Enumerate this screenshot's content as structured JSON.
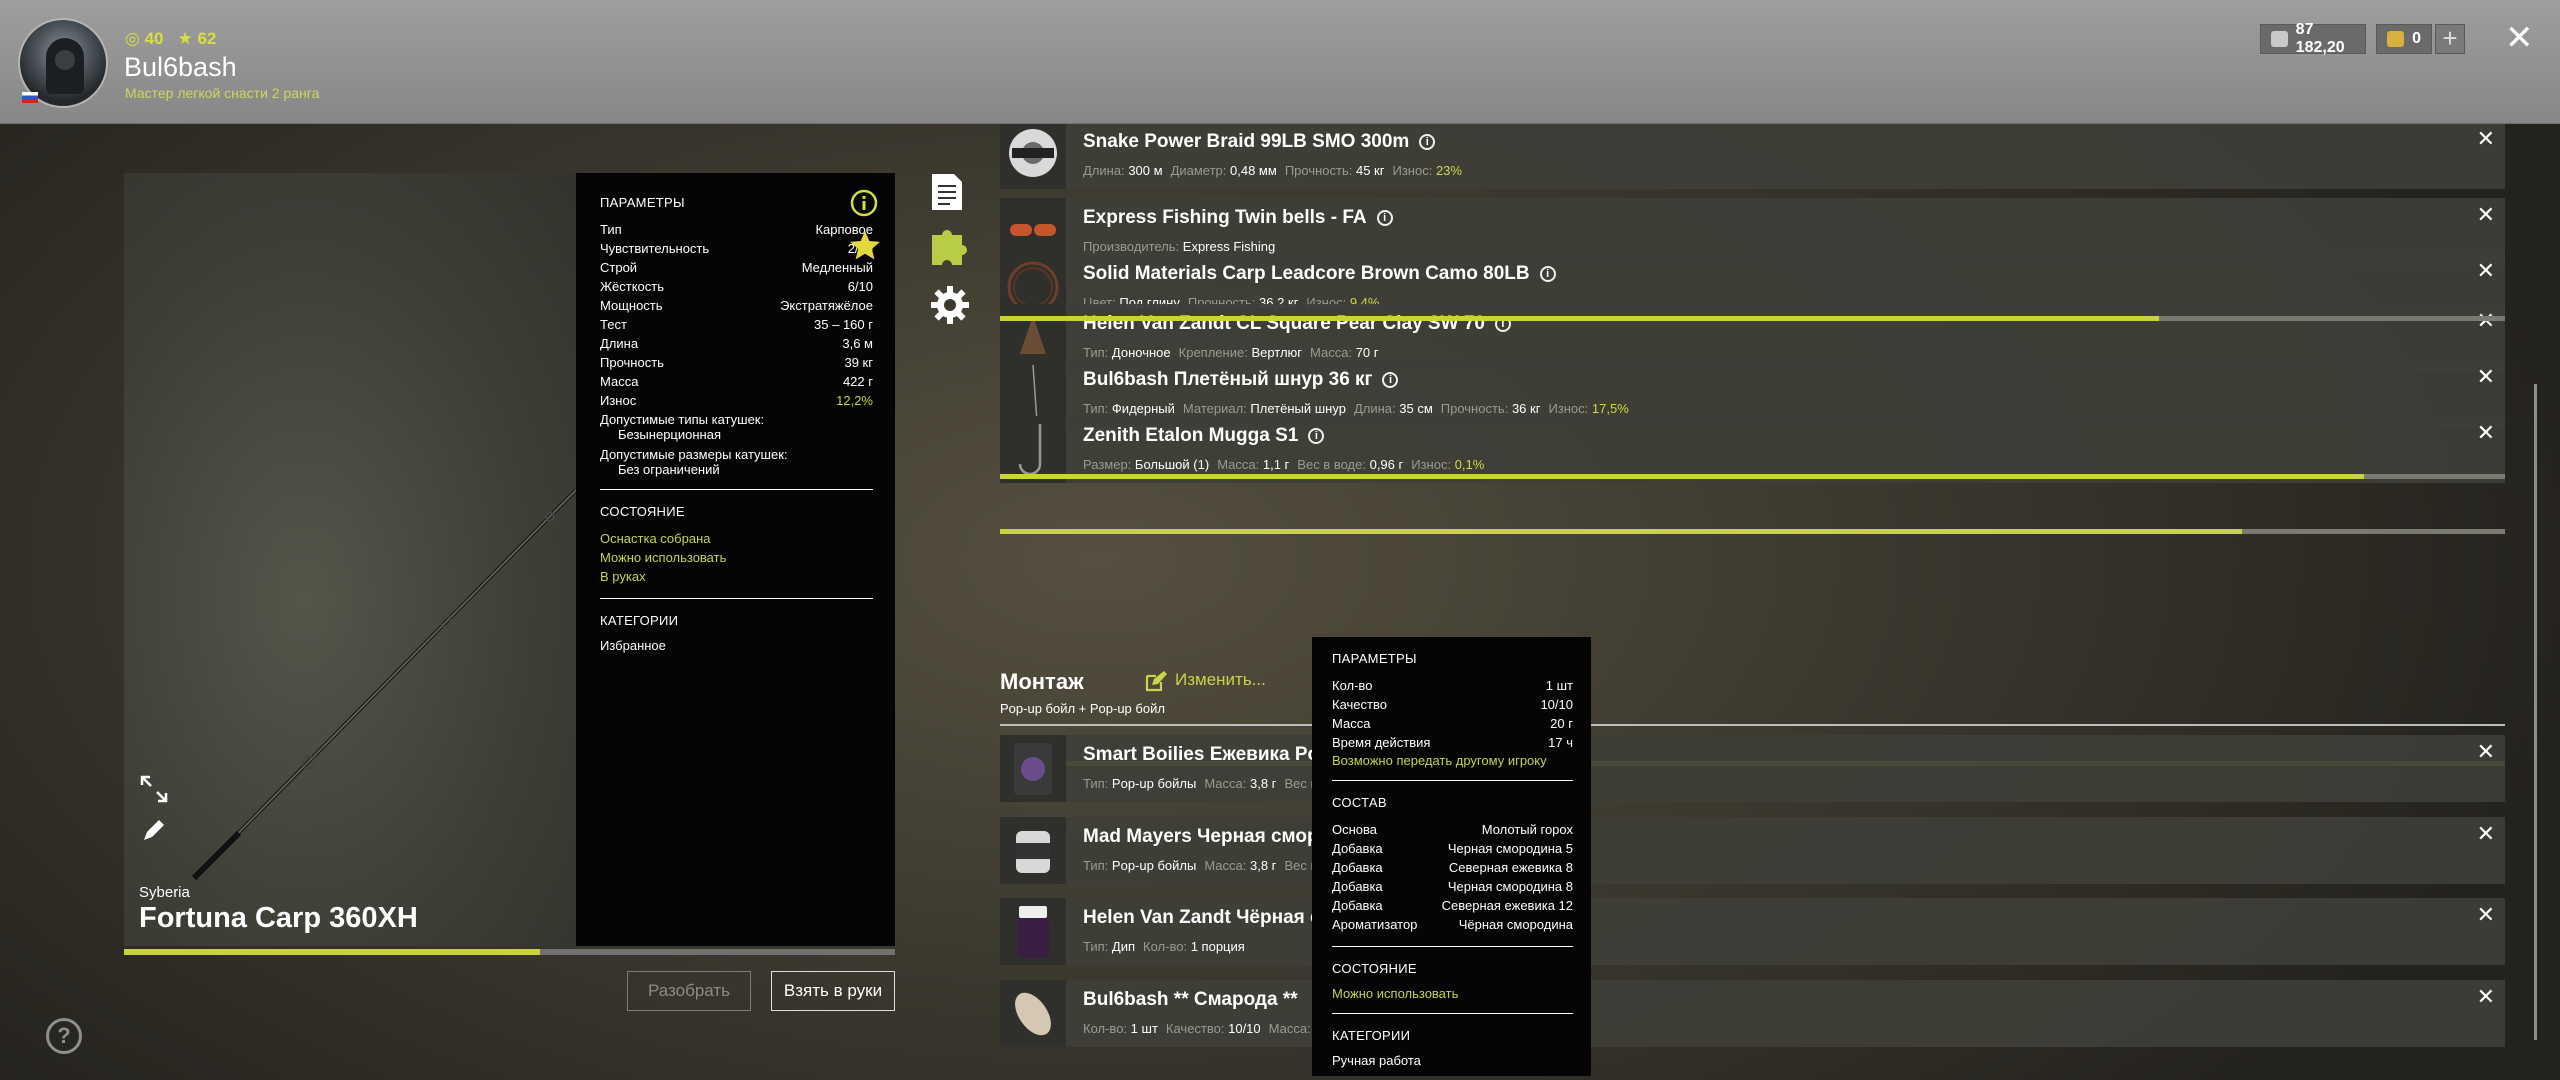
{
  "header": {
    "username": "Bul6bash",
    "rank": "Мастер легкой снасти 2 ранга",
    "level": "40",
    "stars": "62",
    "silver": "87 182,20",
    "gold": "0",
    "plus": "+",
    "close": "✕"
  },
  "rod": {
    "maker": "Syberia",
    "name": "Fortuna Carp 360XH",
    "wear_fraction": 0.54,
    "buttons": {
      "disassemble": "Разобрать",
      "take": "Взять в руки"
    },
    "params_title": "ПАРАМЕТРЫ",
    "params": [
      {
        "k": "Тип",
        "v": "Карповое"
      },
      {
        "k": "Чувствительность",
        "v": "2/10"
      },
      {
        "k": "Строй",
        "v": "Медленный"
      },
      {
        "k": "Жёсткость",
        "v": "6/10"
      },
      {
        "k": "Мощность",
        "v": "Экстратяжёлое"
      },
      {
        "k": "Тест",
        "v": "35 – 160 г"
      },
      {
        "k": "Длина",
        "v": "3,6 м"
      },
      {
        "k": "Прочность",
        "v": "39 кг"
      },
      {
        "k": "Масса",
        "v": "422 г"
      },
      {
        "k": "Износ",
        "v": "12,2%"
      }
    ],
    "reel_types_label": "Допустимые типы катушек:",
    "reel_types_value": "Безынерционная",
    "reel_sizes_label": "Допустимые размеры катушек:",
    "reel_sizes_value": "Без ограничений",
    "state_title": "СОСТОЯНИЕ",
    "state": [
      "Оснастка собрана",
      "Можно использовать",
      "В руках"
    ],
    "cat_title": "КАТЕГОРИИ",
    "cat": "Избранное"
  },
  "items": [
    {
      "name": "Snake Power Braid 99LB SMO 300m",
      "props": [
        {
          "k": "Длина:",
          "v": "300 м"
        },
        {
          "k": "Диаметр:",
          "v": "0,48 мм"
        },
        {
          "k": "Прочность:",
          "v": "45 кг"
        },
        {
          "k": "Износ:",
          "v": "23%",
          "g": true
        }
      ],
      "wear": 0.77
    },
    {
      "name": "Express Fishing Twin bells - FA",
      "props": [
        {
          "k": "Производитель:",
          "v": "Express Fishing"
        }
      ]
    },
    {
      "name": "Solid Materials Carp Leadcore Brown Camo 80LB",
      "props": [
        {
          "k": "Цвет:",
          "v": "Под глину"
        },
        {
          "k": "Прочность:",
          "v": "36,2 кг"
        },
        {
          "k": "Износ:",
          "v": "9,4%",
          "g": true
        }
      ],
      "wear": 0.906
    },
    {
      "name": "Helen Van Zandt CL Square Pear Clay SW 70",
      "props": [
        {
          "k": "Тип:",
          "v": "Доночное"
        },
        {
          "k": "Крепление:",
          "v": "Вертлюг"
        },
        {
          "k": "Масса:",
          "v": "70 г"
        }
      ]
    },
    {
      "name": "Bul6bash Плетёный шнур 36 кг",
      "props": [
        {
          "k": "Тип:",
          "v": "Фидерный"
        },
        {
          "k": "Материал:",
          "v": "Плетёный шнур"
        },
        {
          "k": "Длина:",
          "v": "35 см"
        },
        {
          "k": "Прочность:",
          "v": "36 кг"
        },
        {
          "k": "Износ:",
          "v": "17,5%",
          "g": true
        }
      ],
      "wear": 0.825
    },
    {
      "name": "Zenith Etalon Mugga S1",
      "props": [
        {
          "k": "Размер:",
          "v": "Большой (1)"
        },
        {
          "k": "Масса:",
          "v": "1,1 г"
        },
        {
          "k": "Вес в воде:",
          "v": "0,96 г"
        },
        {
          "k": "Износ:",
          "v": "0,1%",
          "g": true
        }
      ],
      "wear": 0.999
    }
  ],
  "montage": {
    "title": "Монтаж",
    "edit": "Изменить...",
    "subtitle": "Pop-up бойл  +  Pop-up бойл"
  },
  "baits": [
    {
      "name": "Smart Boilies Ежевика Pop",
      "props": [
        {
          "k": "Тип:",
          "v": "Pop-up бойлы"
        },
        {
          "k": "Масса:",
          "v": "3,8 г"
        },
        {
          "k": "Вес в",
          "v": ""
        }
      ]
    },
    {
      "name": "Mad Mayers Черная сморо",
      "props": [
        {
          "k": "Тип:",
          "v": "Pop-up бойлы"
        },
        {
          "k": "Масса:",
          "v": "3,8 г"
        },
        {
          "k": "Вес в",
          "v": ""
        }
      ]
    },
    {
      "name": "Helen Van Zandt Чёрная см",
      "props": [
        {
          "k": "Тип:",
          "v": "Дип"
        },
        {
          "k": "Кол-во:",
          "v": "1 порция"
        }
      ]
    },
    {
      "name": "Bul6bash ** Смарода **",
      "props": [
        {
          "k": "Кол-во:",
          "v": "1 шт"
        },
        {
          "k": "Качество:",
          "v": "10/10"
        },
        {
          "k": "Масса:",
          "v": "2"
        }
      ]
    }
  ],
  "tooltip": {
    "params_title": "ПАРАМЕТРЫ",
    "params": [
      {
        "k": "Кол-во",
        "v": "1 шт"
      },
      {
        "k": "Качество",
        "v": "10/10"
      },
      {
        "k": "Масса",
        "v": "20 г"
      },
      {
        "k": "Время действия",
        "v": "17 ч"
      }
    ],
    "transfer": "Возможно передать другому игроку",
    "comp_title": "СОСТАВ",
    "comp": [
      {
        "k": "Основа",
        "v": "Молотый горох"
      },
      {
        "k": "Добавка",
        "v": "Черная смородина 5"
      },
      {
        "k": "Добавка",
        "v": "Северная ежевика 8"
      },
      {
        "k": "Добавка",
        "v": "Черная смородина 8"
      },
      {
        "k": "Добавка",
        "v": "Северная ежевика 12"
      },
      {
        "k": "Ароматизатор",
        "v": "Чёрная смородина"
      }
    ],
    "state_title": "СОСТОЯНИЕ",
    "state": "Можно использовать",
    "cat_title": "КАТЕГОРИИ",
    "cat": "Ручная работа"
  },
  "colors": {
    "accent": "#c9d33b",
    "topbar": "#8f8f8f",
    "panel": "#050505"
  },
  "icons": [
    "document-icon",
    "puzzle-icon",
    "gear-icon",
    "info-icon",
    "star-icon",
    "expand-icon",
    "pencil-icon",
    "edit-icon",
    "close-icon",
    "help-icon"
  ]
}
